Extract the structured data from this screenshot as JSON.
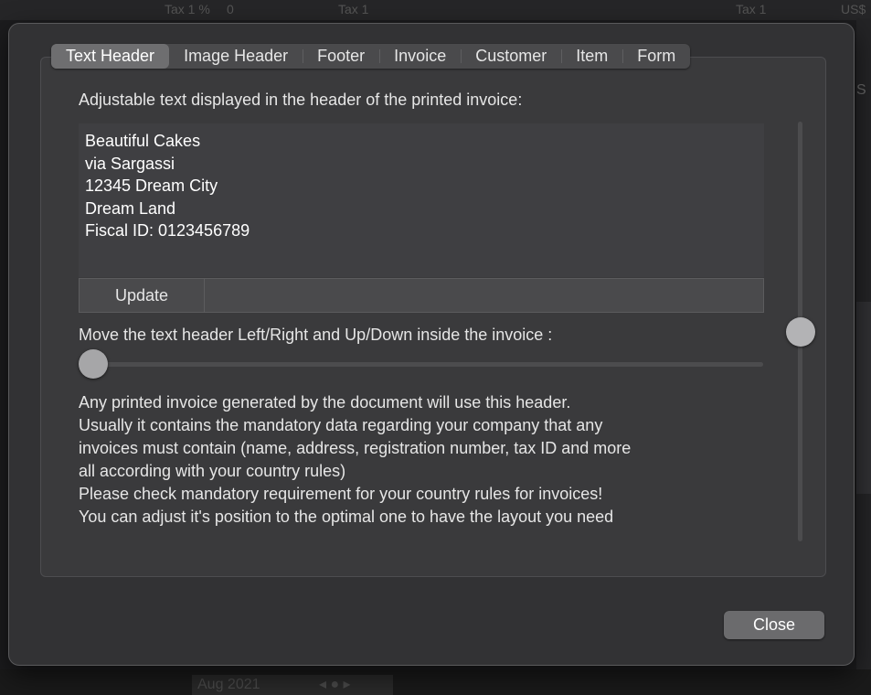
{
  "background": {
    "top_items": [
      "Tax 1 %",
      "0",
      "Tax 1",
      "Tax 1",
      "US$"
    ],
    "right_fragment": "S",
    "bottom_month": "Aug 2021"
  },
  "tabs": [
    {
      "label": "Text Header",
      "active": true
    },
    {
      "label": "Image Header",
      "active": false
    },
    {
      "label": "Footer",
      "active": false
    },
    {
      "label": "Invoice",
      "active": false
    },
    {
      "label": "Customer",
      "active": false
    },
    {
      "label": "Item",
      "active": false
    },
    {
      "label": "Form",
      "active": false
    }
  ],
  "text_header": {
    "caption": "Adjustable text displayed in the header of the printed invoice:",
    "header_lines": [
      "Beautiful Cakes",
      "via Sargassi",
      "12345 Dream City",
      "Dream Land",
      "Fiscal ID: 0123456789"
    ],
    "update_label": "Update",
    "move_caption": "Move the text header Left/Right and Up/Down inside the invoice :",
    "horizontal_position": 0.0,
    "vertical_position": 0.5,
    "description_lines": [
      "Any printed invoice generated by  the document will use this header.",
      "Usually it contains the mandatory data regarding your company that any",
      "invoices must contain (name, address, registration number, tax ID and more",
      "all according with your country rules)",
      "Please check mandatory requirement for your country rules for invoices!",
      "You can adjust it's position to the optimal one to have the layout you need"
    ]
  },
  "close_label": "Close"
}
